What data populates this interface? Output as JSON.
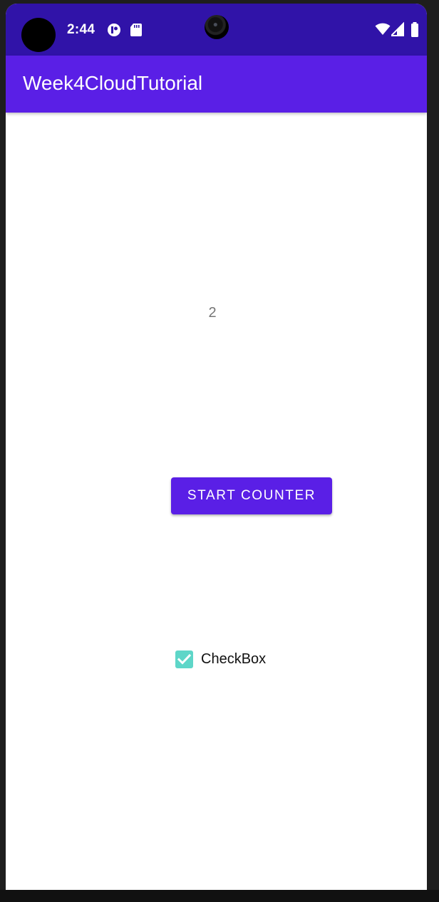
{
  "status_bar": {
    "time": "2:44",
    "icons_left": [
      "notification-icon",
      "sd-card-icon"
    ],
    "icons_right": [
      "wifi-icon",
      "cellular-signal-icon",
      "battery-icon"
    ],
    "background_color": "#3013a8"
  },
  "app_bar": {
    "title": "Week4CloudTutorial",
    "background_color": "#5a1fe6"
  },
  "main": {
    "counter_value": "2",
    "start_button_label": "START COUNTER",
    "checkbox": {
      "label": "CheckBox",
      "checked": true,
      "color": "#5ed6c8"
    }
  }
}
